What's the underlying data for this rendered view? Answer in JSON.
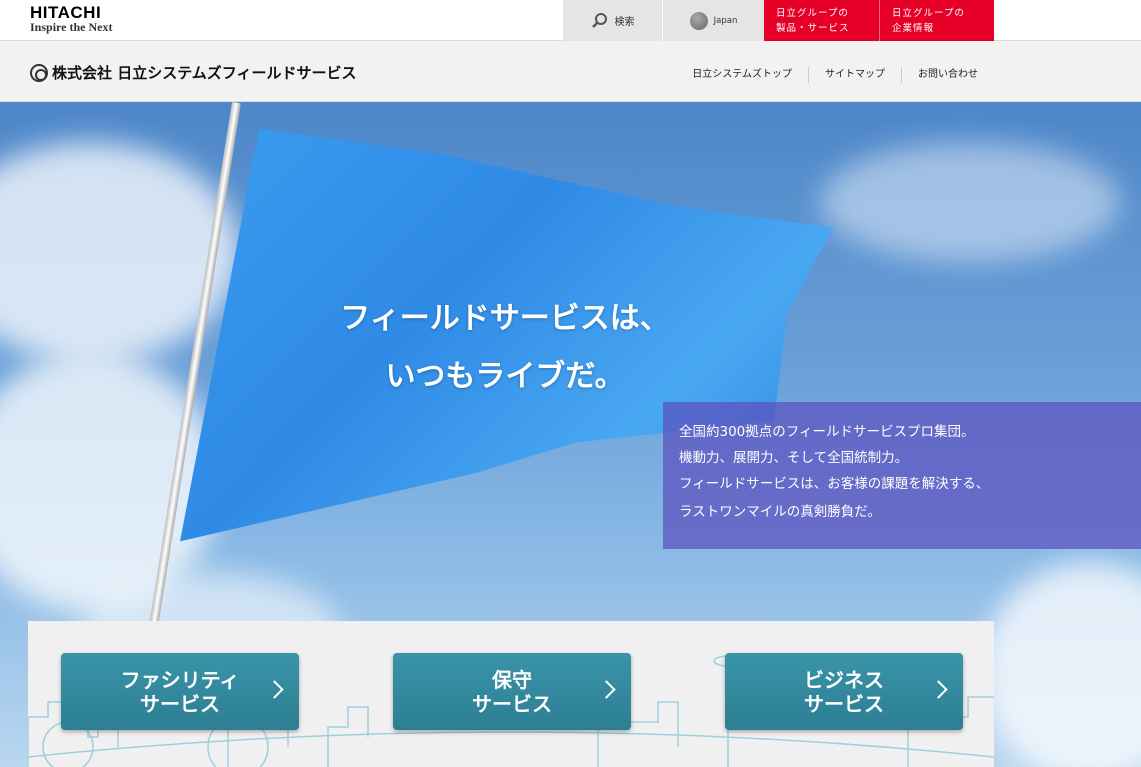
{
  "logo": {
    "main": "HITACHI",
    "sub": "Inspire the Next"
  },
  "topnav": {
    "search_label": "検索",
    "lang_label": "Japan",
    "group_products": [
      "日立グループの",
      "製品・サービス"
    ],
    "group_corporate": [
      "日立グループの",
      "企業情報"
    ]
  },
  "header": {
    "company_name": "株式会社 日立システムズフィールドサービス",
    "links": [
      "日立システムズトップ",
      "サイトマップ",
      "お問い合わせ"
    ]
  },
  "hero": {
    "tagline": [
      "フィールドサービスは、",
      "いつもライブだ。"
    ],
    "description": [
      "全国約300拠点のフィールドサービスプロ集団。",
      "機動力、展開力、そして全国統制力。",
      "フィールドサービスは、お客様の課題を解決する、",
      "ラストワンマイルの真剣勝負だ。"
    ]
  },
  "services": [
    {
      "line1": "ファシリティ",
      "line2": "サービス"
    },
    {
      "line1": "保守",
      "line2": "サービス"
    },
    {
      "line1": "ビジネス",
      "line2": "サービス"
    }
  ],
  "colors": {
    "accent_red": "#e60027",
    "service_teal": "#2d7e93",
    "desc_overlay": "#5c50be"
  }
}
